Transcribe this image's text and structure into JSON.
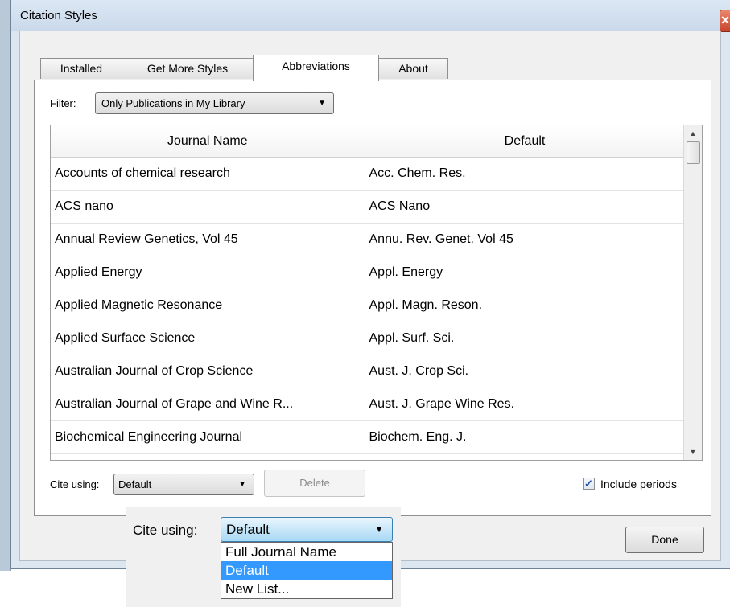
{
  "window": {
    "title": "Citation Styles",
    "close_glyph": "✕"
  },
  "tabs": [
    {
      "label": "Installed",
      "active": false
    },
    {
      "label": "Get More Styles",
      "active": false
    },
    {
      "label": "Abbreviations",
      "active": true
    },
    {
      "label": "About",
      "active": false
    }
  ],
  "filter": {
    "label": "Filter:",
    "value": "Only Publications in My Library"
  },
  "table": {
    "columns": [
      "Journal Name",
      "Default"
    ],
    "rows": [
      [
        "Accounts of chemical research",
        "Acc. Chem. Res."
      ],
      [
        "ACS nano",
        "ACS Nano"
      ],
      [
        "Annual Review Genetics, Vol 45",
        "Annu. Rev. Genet. Vol 45"
      ],
      [
        "Applied Energy",
        "Appl. Energy"
      ],
      [
        "Applied Magnetic Resonance",
        "Appl. Magn. Reson."
      ],
      [
        "Applied Surface Science",
        "Appl. Surf. Sci."
      ],
      [
        "Australian Journal of Crop Science",
        "Aust. J. Crop Sci."
      ],
      [
        "Australian Journal of Grape and Wine R...",
        "Aust. J. Grape Wine Res."
      ],
      [
        "Biochemical Engineering Journal",
        "Biochem. Eng. J."
      ]
    ]
  },
  "cite_using": {
    "label": "Cite using:",
    "value": "Default"
  },
  "delete_label": "Delete",
  "include_periods": {
    "label": "Include periods",
    "checked": true
  },
  "done_label": "Done",
  "zoom_callout": {
    "label": "Cite using:",
    "value": "Default",
    "options": [
      "Full Journal Name",
      "Default",
      "New List..."
    ],
    "selected_index": 1
  },
  "colors": {
    "selection": "#3399ff",
    "window_frame": "#dce6f1"
  }
}
